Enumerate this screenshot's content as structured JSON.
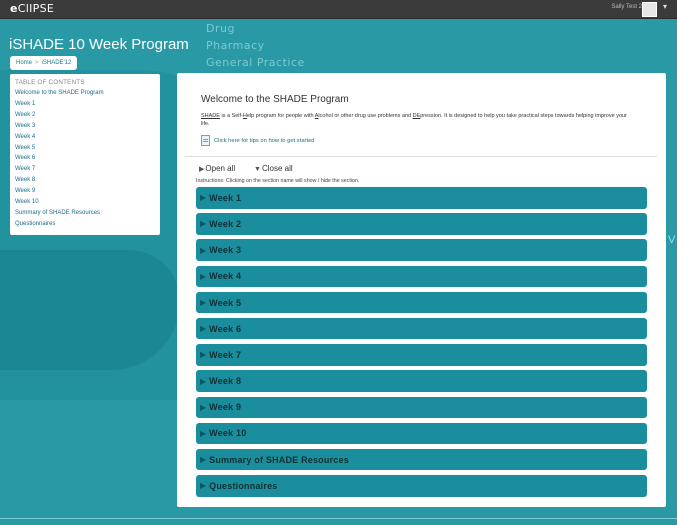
{
  "topbar": {
    "logo_prefix": "e",
    "logo_rest": "ClIPSE",
    "user_name": "Sally Test 2",
    "menu_caret": "▾"
  },
  "background": {
    "words": [
      "Drug",
      "Pharmacy",
      "General Practice"
    ],
    "side_letter": "V"
  },
  "page": {
    "title": "iSHADE 10 Week Program"
  },
  "breadcrumb": {
    "home": "Home",
    "separator": ">",
    "current": "iSHADE'12"
  },
  "toc": {
    "title": "TABLE OF CONTENTS",
    "items": [
      "Welcome to the SHADE Program",
      "Week 1",
      "Week 2",
      "Week 3",
      "Week 4",
      "Week 5",
      "Week 6",
      "Week 7",
      "Week 8",
      "Week 9",
      "Week 10",
      "Summary of SHADE Resources",
      "Questionnaires"
    ]
  },
  "main": {
    "title": "Welcome to the SHADE Program",
    "intro": {
      "p1": "SHADE",
      "p2": " is a Self-",
      "p3": "H",
      "p4": "elp program for people with ",
      "p5": "A",
      "p6": "lcohol or other drug use problems and ",
      "p7": "DE",
      "p8": "pression. It is designed to help you take practical steps towards helping improve your life."
    },
    "tips_link": "Click here for tips on how to get started",
    "open_all": "Open all",
    "close_all": "Close all",
    "open_icon": "▶",
    "close_icon": "▼",
    "instructions": "Instructions: Clicking on the section name will show / hide the section.",
    "section_icon": "▶",
    "sections": [
      "Week 1",
      "Week 2",
      "Week 3",
      "Week 4",
      "Week 5",
      "Week 6",
      "Week 7",
      "Week 8",
      "Week 9",
      "Week 10",
      "Summary of SHADE Resources",
      "Questionnaires"
    ]
  },
  "colors": {
    "background": "#2a99a6",
    "section_bar": "#1b8e9e",
    "topbar": "#3b3b3b",
    "link": "#1a6e8a"
  }
}
